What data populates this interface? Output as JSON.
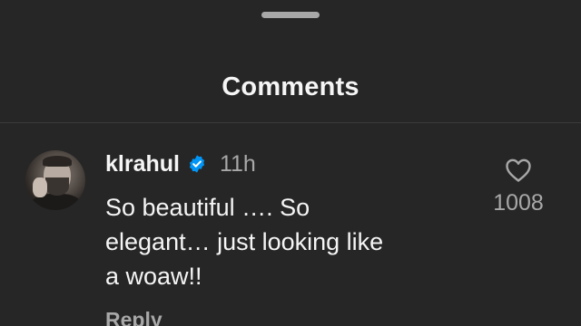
{
  "header": {
    "title": "Comments"
  },
  "comment": {
    "username": "klrahul",
    "verified": true,
    "timestamp": "11h",
    "text": "So beautiful …. So\nelegant… just looking like\na woaw!!",
    "reply_label": "Reply",
    "like_count": "1008",
    "like_icon": "heart-outline-icon"
  },
  "colors": {
    "background": "#262626",
    "primary_text": "#f5f5f5",
    "secondary_text": "#a8a8a8",
    "verified_badge": "#0095f6"
  }
}
